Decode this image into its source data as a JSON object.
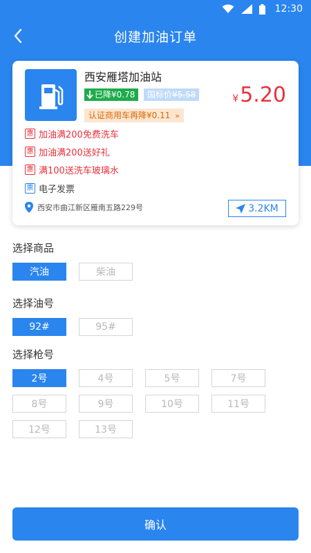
{
  "status_bar": {
    "time": "12:30"
  },
  "nav": {
    "title": "创建加油订单"
  },
  "station": {
    "name": "西安雁塔加油站",
    "price_currency": "¥",
    "price": "5.20",
    "drop_tag": "已降¥0.78",
    "national_label": "国标价",
    "national_price": "¥5.58",
    "verify_tag": "认证商用车再降¥0.11",
    "promotions": [
      {
        "badge": "惠",
        "text": "加油满200免费洗车"
      },
      {
        "badge": "惠",
        "text": "加油满200送好礼"
      },
      {
        "badge": "惠",
        "text": "满100送洗车玻璃水"
      }
    ],
    "invoice": {
      "badge": "票",
      "text": "电子发票"
    },
    "address": "西安市曲江新区雁南五路229号",
    "distance": "3.2KM"
  },
  "goods": {
    "title": "选择商品",
    "options": [
      "汽油",
      "柴油"
    ],
    "selected": "汽油"
  },
  "oil_number": {
    "title": "选择油号",
    "options": [
      "92#",
      "95#"
    ],
    "selected": "92#"
  },
  "gun_number": {
    "title": "选择枪号",
    "options": [
      "2号",
      "4号",
      "5号",
      "7号",
      "8号",
      "9号",
      "10号",
      "11号",
      "12号",
      "13号"
    ],
    "selected": "2号"
  },
  "confirm_label": "确认",
  "colors": {
    "primary": "#2a85ee",
    "price_red": "#e8313c",
    "drop_green": "#1eab4b",
    "verify_orange": "#d8690e"
  }
}
